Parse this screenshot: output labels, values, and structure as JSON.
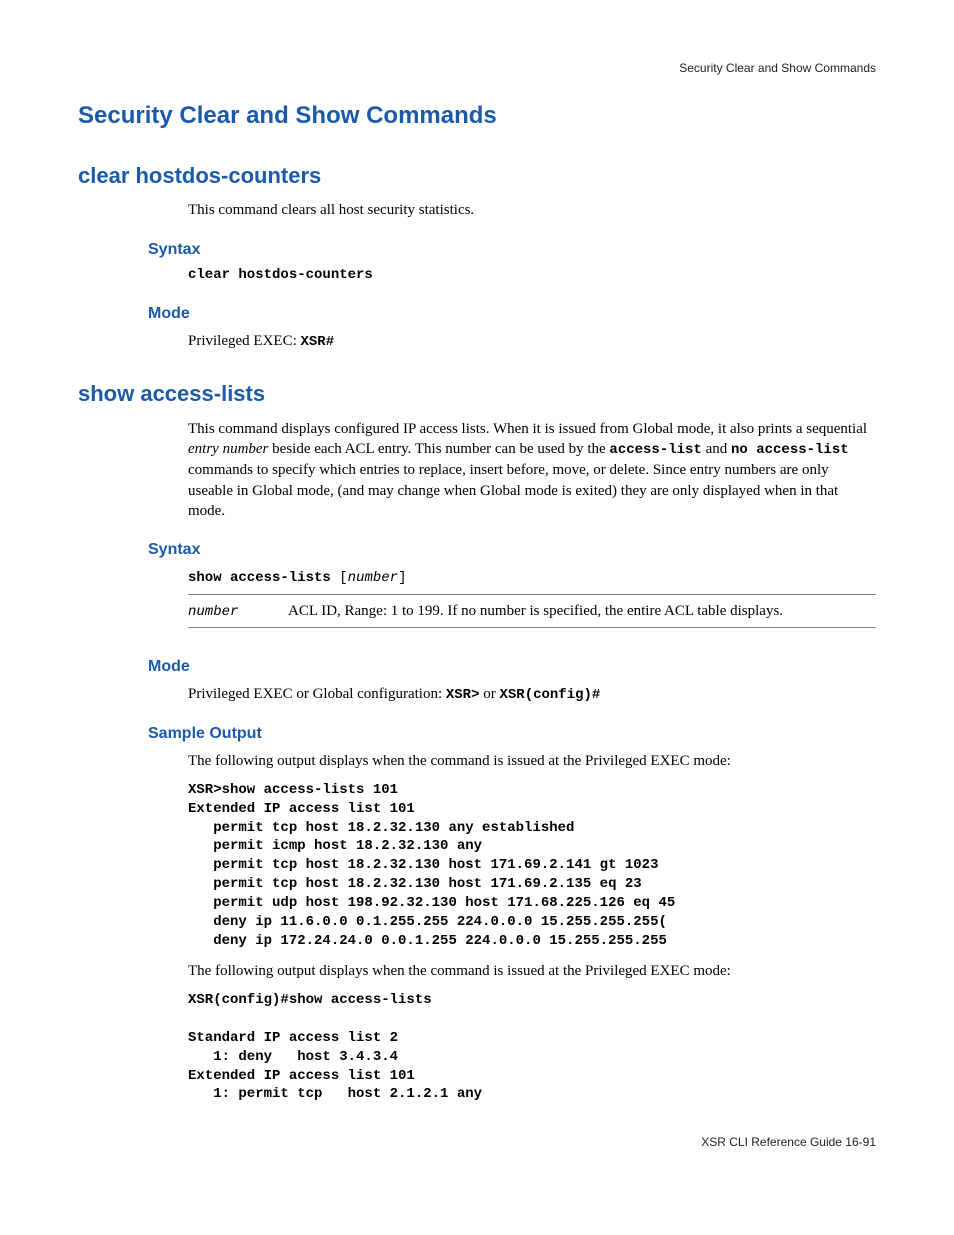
{
  "header": {
    "breadcrumb": "Security Clear and Show Commands"
  },
  "title": "Security Clear and Show Commands",
  "sec1": {
    "heading": "clear hostdos-counters",
    "desc": "This command clears all host security statistics.",
    "syntax_h": "Syntax",
    "syntax_code": "clear hostdos-counters",
    "mode_h": "Mode",
    "mode_prefix": " Privileged EXEC: ",
    "mode_code": "XSR#"
  },
  "sec2": {
    "heading": "show access-lists",
    "desc_p1_a": "This command displays configured IP access lists. When it is issued from Global mode, it also prints a sequential ",
    "desc_p1_em": "entry number",
    "desc_p1_b": " beside each ACL entry. This number can be used by the ",
    "desc_p1_code1": "access-list",
    "desc_p1_mid": " and ",
    "desc_p1_code2": "no access-list",
    "desc_p1_c": " commands to specify which entries to replace, insert before, move, or delete.  Since entry numbers are only useable in Global mode, (and may change when Global mode is exited) they are only displayed when in that mode.",
    "syntax_h": "Syntax",
    "syntax_code_a": "show access-lists ",
    "syntax_code_br1": "[",
    "syntax_code_num": "number",
    "syntax_code_br2": "]",
    "param_name": "number",
    "param_desc": "ACL ID, Range: 1 to 199. If no number is specified, the entire ACL table displays.",
    "mode_h": "Mode",
    "mode_text_a": "Privileged EXEC or Global configuration: ",
    "mode_code1": "XSR>",
    "mode_or": " or ",
    "mode_code2": "XSR(config)#",
    "sample_h": "Sample Output",
    "sample_intro1": "The following output displays when the command is issued at the Privileged EXEC mode:",
    "sample_block1": "XSR>show access-lists 101\nExtended IP access list 101\n   permit tcp host 18.2.32.130 any established\n   permit icmp host 18.2.32.130 any\n   permit tcp host 18.2.32.130 host 171.69.2.141 gt 1023\n   permit tcp host 18.2.32.130 host 171.69.2.135 eq 23\n   permit udp host 198.92.32.130 host 171.68.225.126 eq 45\n   deny ip 11.6.0.0 0.1.255.255 224.0.0.0 15.255.255.255(\n   deny ip 172.24.24.0 0.0.1.255 224.0.0.0 15.255.255.255",
    "sample_intro2": "The following output displays when the command is issued at the Privileged EXEC mode:",
    "sample_block2": "XSR(config)#show access-lists\n\nStandard IP access list 2\n   1: deny   host 3.4.3.4\nExtended IP access list 101\n   1: permit tcp   host 2.1.2.1 any"
  },
  "footer": {
    "text": "XSR CLI Reference Guide   16-91"
  }
}
